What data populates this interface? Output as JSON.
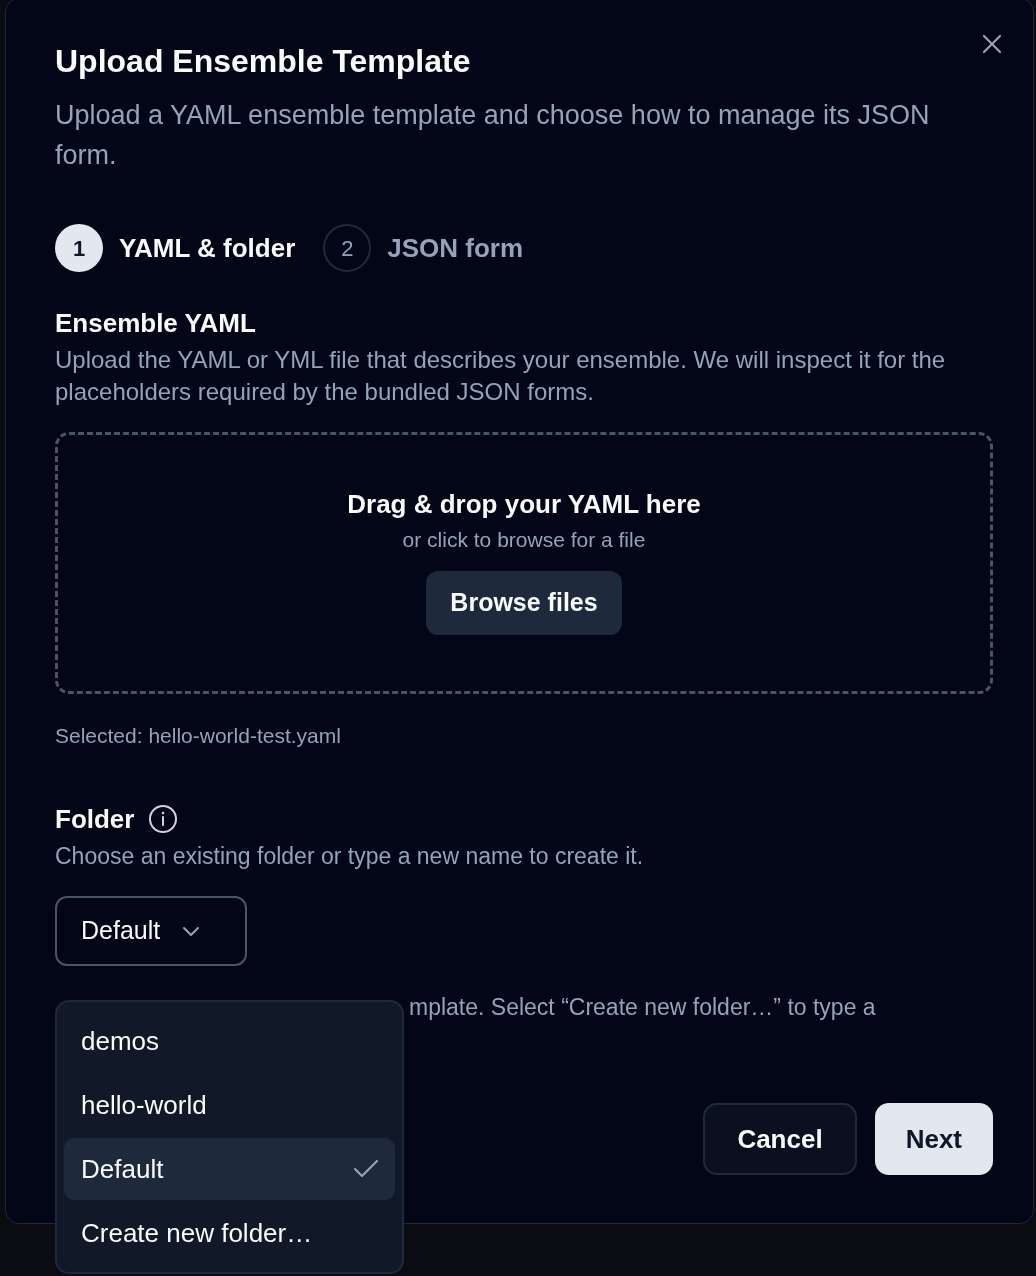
{
  "dialog": {
    "title": "Upload Ensemble Template",
    "description": "Upload a YAML ensemble template and choose how to manage its JSON form."
  },
  "steps": [
    {
      "number": "1",
      "label": "YAML & folder",
      "selected": true
    },
    {
      "number": "2",
      "label": "JSON form",
      "selected": false
    }
  ],
  "yaml_section": {
    "heading": "Ensemble YAML",
    "help": "Upload the YAML or YML file that describes your ensemble. We will inspect it for the placeholders required by the bundled JSON forms.",
    "dropzone": {
      "title": "Drag & drop your YAML here",
      "subtitle": "or click to browse for a file",
      "button": "Browse files"
    },
    "selected_file": "Selected: hello-world-test.yaml"
  },
  "folder_section": {
    "heading": "Folder",
    "help": "Choose an existing folder or type a new name to create it.",
    "select": {
      "value": "Default",
      "expanded": true
    },
    "hint": "mplate. Select “Create new folder…” to type a"
  },
  "dropdown": {
    "options": [
      {
        "label": "demos",
        "selected": false
      },
      {
        "label": "hello-world",
        "selected": false
      },
      {
        "label": "Default",
        "selected": true
      },
      {
        "label": "Create new folder…",
        "selected": false
      }
    ]
  },
  "buttons": [
    {
      "label": "Cancel",
      "kind": "secondary"
    },
    {
      "label": "Next",
      "kind": "primary"
    }
  ]
}
